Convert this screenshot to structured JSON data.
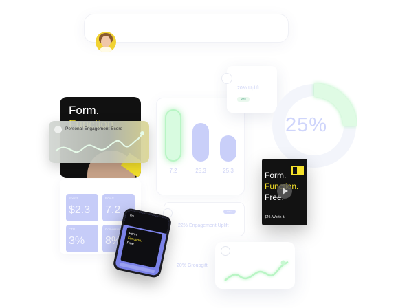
{
  "header": {
    "avatar_icon": "user-avatar"
  },
  "ad_card": {
    "line1": "Form.",
    "line2": "Function."
  },
  "engagement_overlay": {
    "label": "Personal Engagement Score"
  },
  "stats": [
    {
      "title": "Spend",
      "value": "$2.3"
    },
    {
      "title": "ROAS",
      "value": "7.2"
    },
    {
      "title": "CTR",
      "value": "3%"
    },
    {
      "title": "Conversion",
      "value": "8%"
    }
  ],
  "bars": {
    "labels": [
      "7.2",
      "25.3",
      "25.3"
    ],
    "levels": [
      1.0,
      0.74,
      0.5
    ]
  },
  "upgrade_card": {
    "title": "20% Uplift",
    "button": "View"
  },
  "donut": {
    "value": "25%",
    "fraction": 0.25
  },
  "video_card": {
    "line1": "Form.",
    "line2": "Function.",
    "line3": "Free.",
    "price": "$49. Worth it.",
    "play_icon": "play-icon"
  },
  "uplifts": {
    "engagement": "22% Engagement Uplift",
    "engagement_pill": "Label",
    "second": "20% Groupgift"
  },
  "phone": {
    "header": "Pro",
    "line1": "Form.",
    "line2": "Function.",
    "line3": "Free."
  },
  "colors": {
    "accent_yellow": "#f5e12a",
    "lavender": "#c6ccf8",
    "mint": "#b8f5c4"
  }
}
